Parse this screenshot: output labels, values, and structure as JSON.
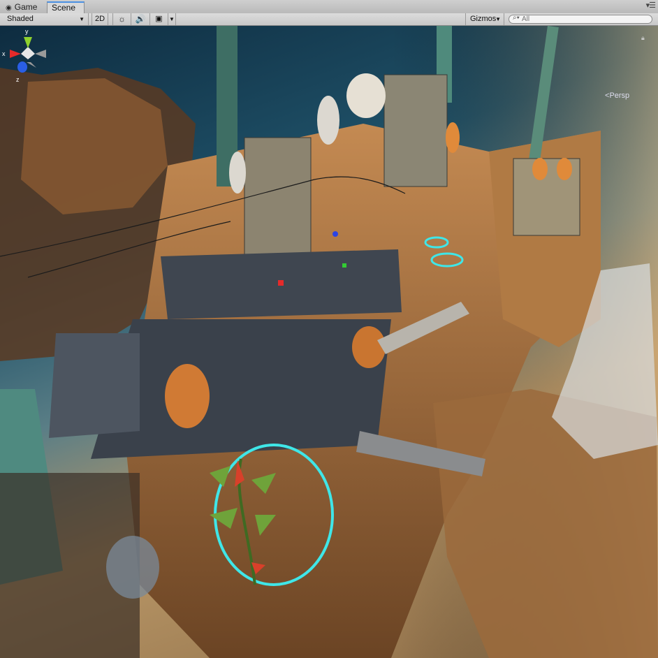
{
  "tabs": [
    {
      "label": "Game",
      "icon": "gamepad-icon",
      "active": false
    },
    {
      "label": "Scene",
      "icon": "cube-icon",
      "active": true
    }
  ],
  "toolbar": {
    "shading_mode": "Shaded",
    "toggle_2d": "2D",
    "lighting_icon": "☼",
    "audio_icon": "🔊",
    "effects_icon": "▣",
    "gizmos_label": "Gizmos",
    "search": {
      "placeholder": "All",
      "value": ""
    }
  },
  "gizmo": {
    "x_label": "x",
    "y_label": "y",
    "z_label": "z",
    "projection": "Persp",
    "colors": {
      "x": "#e52a2a",
      "y": "#8fd12d",
      "z": "#2a5ee5"
    }
  },
  "accent": {
    "tab_active": "#4a90e2",
    "ring_glow": "#3fe6e8"
  }
}
